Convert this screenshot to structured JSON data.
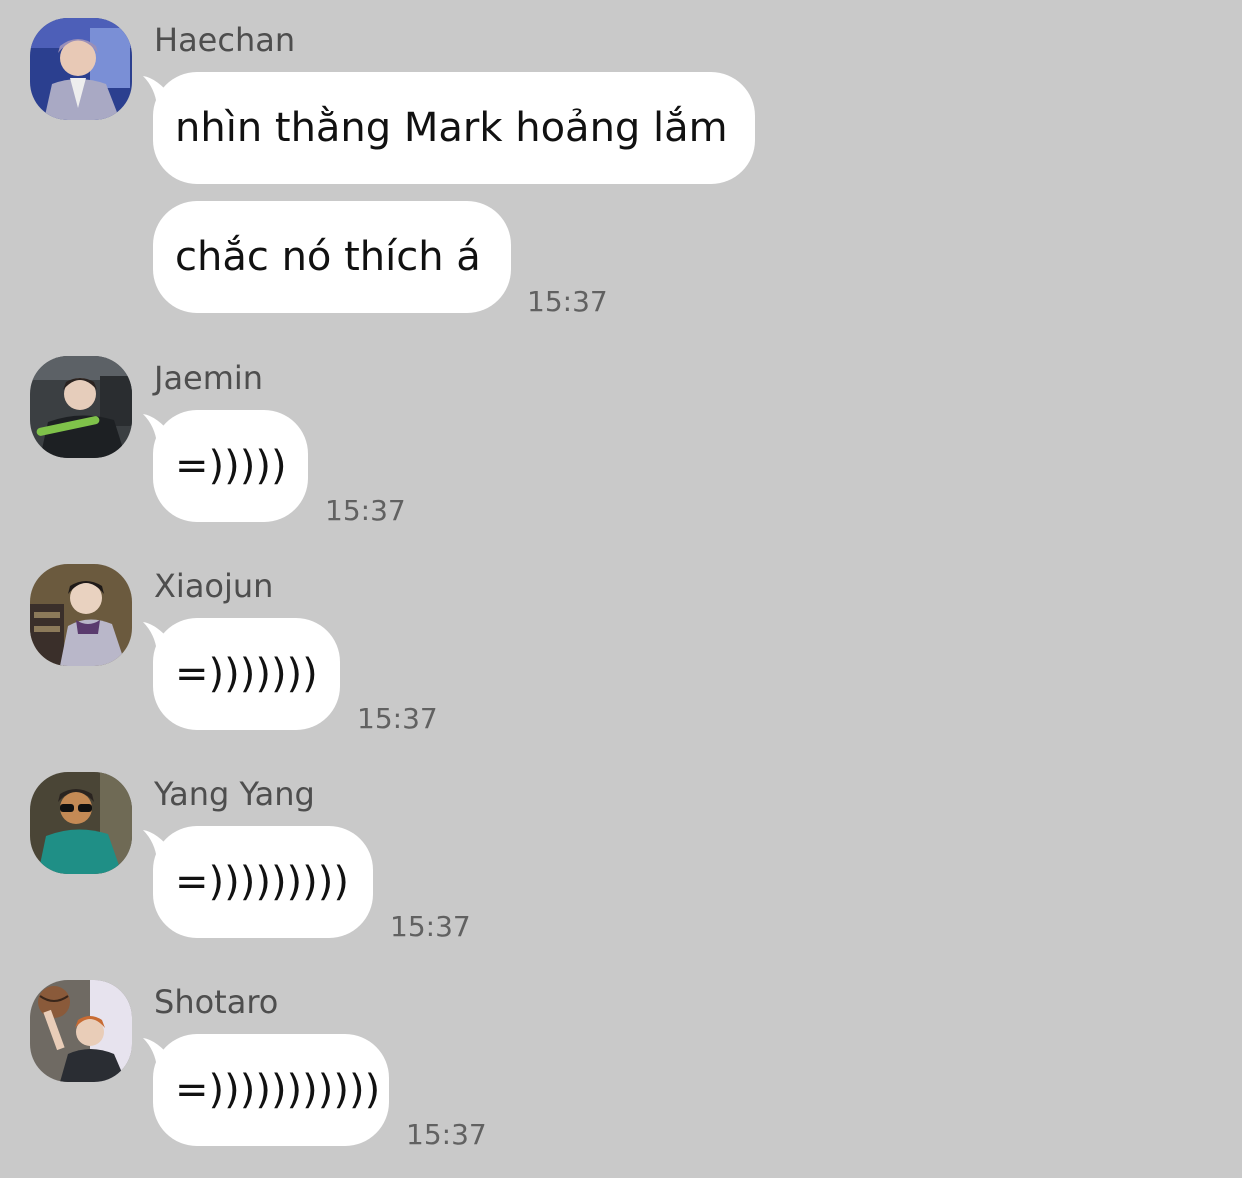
{
  "messages": [
    {
      "sender": "Haechan",
      "avatar": {
        "icon": "haechan-avatar",
        "colors": [
          "#2b3f8f",
          "#7a8fd6",
          "#a9a9c4"
        ]
      },
      "bubbles": [
        "nhìn thằng Mark hoảng lắm",
        "chắc nó thích á"
      ],
      "time": "15:37"
    },
    {
      "sender": "Jaemin",
      "avatar": {
        "icon": "jaemin-avatar",
        "colors": [
          "#3b3f42",
          "#1d2023",
          "#7fc24a"
        ]
      },
      "bubbles": [
        "=)))))"
      ],
      "time": "15:37"
    },
    {
      "sender": "Xiaojun",
      "avatar": {
        "icon": "xiaojun-avatar",
        "colors": [
          "#6b5a3e",
          "#b9b7c9",
          "#3a2f2a"
        ]
      },
      "bubbles": [
        "=)))))))"
      ],
      "time": "15:37"
    },
    {
      "sender": "Yang Yang",
      "avatar": {
        "icon": "yangyang-avatar",
        "colors": [
          "#4a4536",
          "#1f8f86",
          "#c48a55"
        ]
      },
      "bubbles": [
        "=)))))))))"
      ],
      "time": "15:37"
    },
    {
      "sender": "Shotaro",
      "avatar": {
        "icon": "shotaro-avatar",
        "colors": [
          "#6f6a63",
          "#2a2d33",
          "#c86b33"
        ]
      },
      "bubbles": [
        "=)))))))))))"
      ],
      "time": "15:37"
    }
  ]
}
